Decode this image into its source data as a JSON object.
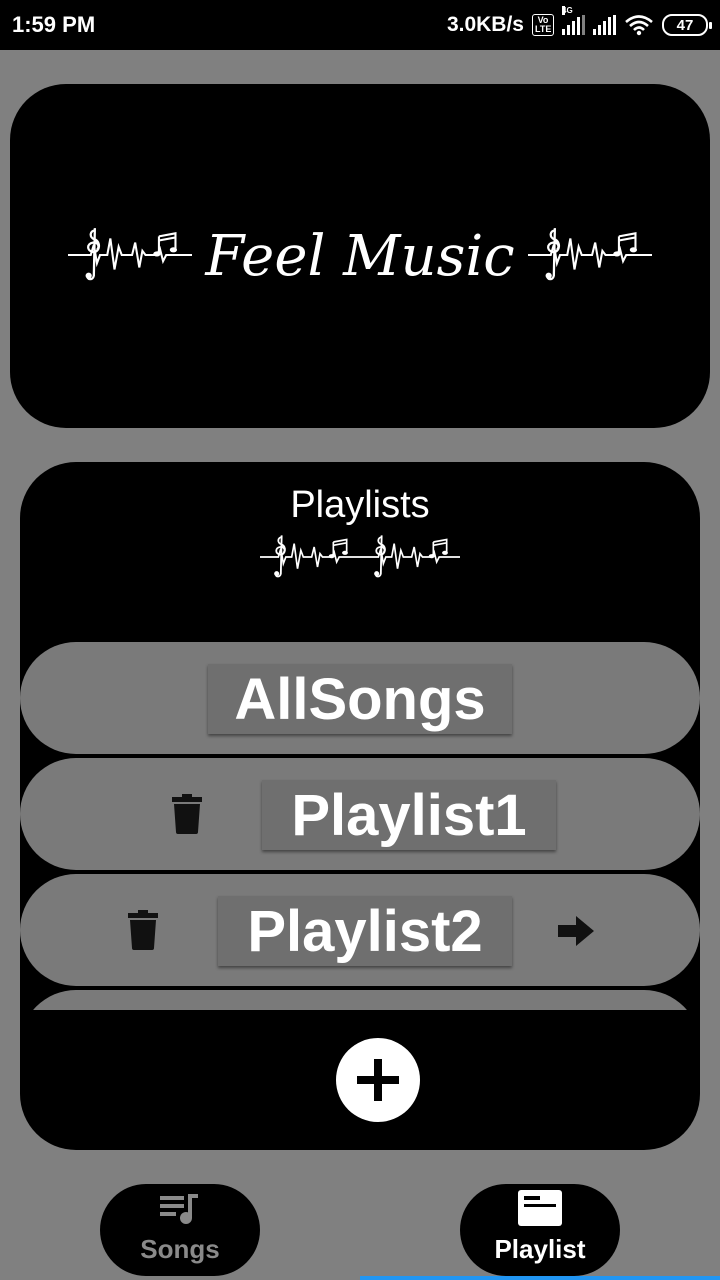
{
  "status_bar": {
    "time": "1:59 PM",
    "speed": "3.0KB/s",
    "volte": "Vo LTE",
    "network": "4G",
    "battery": "47"
  },
  "banner": {
    "title": "Feel Music"
  },
  "playlists": {
    "title": "Playlists",
    "rows": [
      {
        "label": "AllSongs"
      },
      {
        "label": "Playlist1"
      },
      {
        "label": "Playlist2"
      }
    ]
  },
  "nav": {
    "songs_label": "Songs",
    "playlist_label": "Playlist"
  },
  "colors": {
    "background": "#808080",
    "row": "#7a7a7a",
    "active_tab_text": "#ffffff",
    "inactive_tab_text": "#8a8a8a",
    "accent_underline": "#2196f3"
  },
  "icons": {
    "fab": "plus-icon",
    "delete": "trash-icon",
    "open": "arrow-right-icon",
    "songs": "playlist-music-icon",
    "playlist": "album-card-icon"
  }
}
